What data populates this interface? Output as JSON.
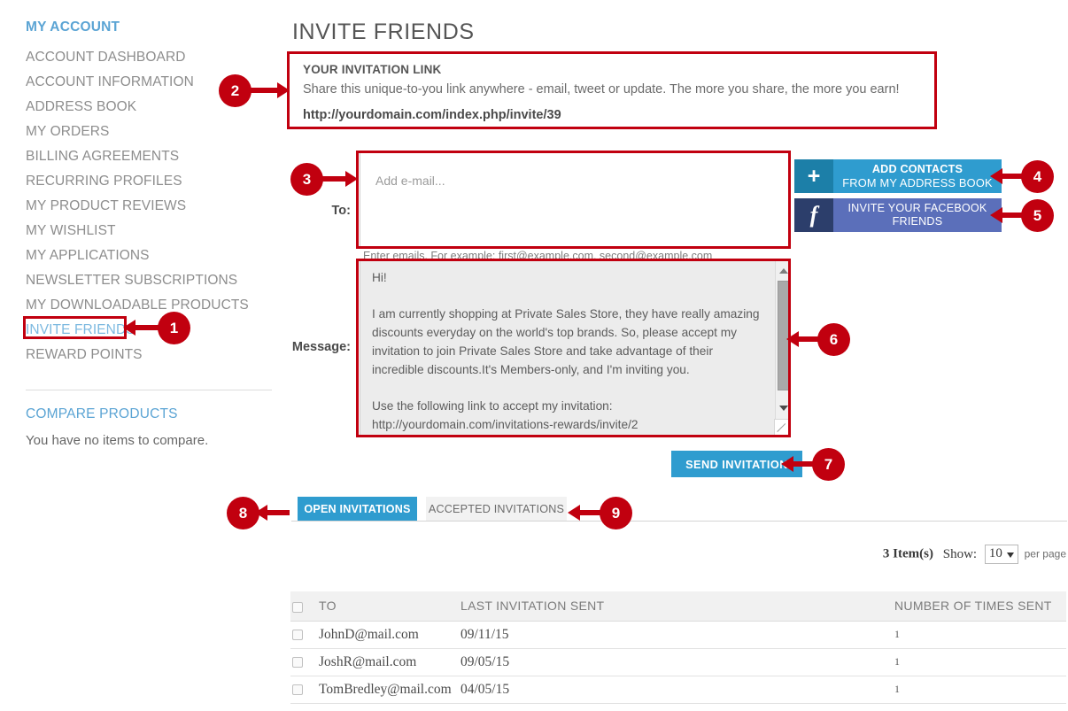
{
  "sidebar": {
    "heading": "MY ACCOUNT",
    "items": [
      {
        "label": "ACCOUNT DASHBOARD",
        "active": false
      },
      {
        "label": "ACCOUNT INFORMATION",
        "active": false
      },
      {
        "label": "ADDRESS BOOK",
        "active": false
      },
      {
        "label": "MY ORDERS",
        "active": false
      },
      {
        "label": "BILLING AGREEMENTS",
        "active": false
      },
      {
        "label": "RECURRING PROFILES",
        "active": false
      },
      {
        "label": "MY PRODUCT REVIEWS",
        "active": false
      },
      {
        "label": "MY WISHLIST",
        "active": false
      },
      {
        "label": "MY APPLICATIONS",
        "active": false
      },
      {
        "label": "NEWSLETTER SUBSCRIPTIONS",
        "active": false
      },
      {
        "label": "MY DOWNLOADABLE PRODUCTS",
        "active": false
      },
      {
        "label": "INVITE FRIENDS",
        "active": true
      },
      {
        "label": "REWARD POINTS",
        "active": false
      }
    ],
    "compare": {
      "heading": "COMPARE PRODUCTS",
      "empty_text": "You have no items to compare."
    }
  },
  "main": {
    "page_title": "INVITE FRIENDS",
    "invitation_panel": {
      "title": "YOUR INVITATION LINK",
      "description": "Share this unique-to-you link anywhere - email, tweet or update. The more you share, the more you earn!",
      "link": "http://yourdomain.com/index.php/invite/39"
    },
    "form": {
      "to_label": "To:",
      "to_placeholder": "Add e-mail...",
      "to_hint": "Enter emails. For example: first@example.com, second@example.com",
      "message_label": "Message:",
      "message_value": "Hi!\n\nI am currently shopping at Private Sales Store, they have really amazing discounts everyday on the world's top brands. So, please accept my invitation to join Private Sales Store and take advantage of their incredible discounts.It's Members-only, and I'm inviting you.\n\nUse the following link to accept my invitation:\nhttp://yourdomain.com/invitations-rewards/invite/2\n",
      "send_button": "SEND INVITATION"
    },
    "actions": {
      "add_contacts": {
        "line1": "ADD CONTACTS",
        "line2": "FROM MY ADDRESS BOOK",
        "icon": "plus-icon"
      },
      "facebook": {
        "line1": "INVITE YOUR FACEBOOK",
        "line2": "FRIENDS",
        "icon": "facebook-icon"
      }
    },
    "tabs": [
      {
        "label": "OPEN INVITATIONS",
        "selected": true
      },
      {
        "label": "ACCEPTED INVITATIONS",
        "selected": false
      }
    ],
    "toolbar": {
      "item_count": "3 Item(s)",
      "show_label": "Show:",
      "per_page_value": "10",
      "per_page_suffix": "per page"
    },
    "table": {
      "columns": [
        "TO",
        "LAST INVITATION SENT",
        "NUMBER OF TIMES SENT"
      ],
      "rows": [
        {
          "to": "JohnD@mail.com",
          "last_sent": "09/11/15",
          "times": "1"
        },
        {
          "to": "JoshR@mail.com",
          "last_sent": "09/05/15",
          "times": "1"
        },
        {
          "to": "TomBredley@mail.com",
          "last_sent": "04/05/15",
          "times": "1"
        }
      ]
    }
  },
  "callouts": [
    {
      "number": "1"
    },
    {
      "number": "2"
    },
    {
      "number": "3"
    },
    {
      "number": "4"
    },
    {
      "number": "5"
    },
    {
      "number": "6"
    },
    {
      "number": "7"
    },
    {
      "number": "8"
    },
    {
      "number": "9"
    }
  ],
  "colors": {
    "accent_blue": "#2f9ccf",
    "link_blue": "#5ba4d4",
    "callout_red": "#c1000f",
    "facebook_blue": "#5b6fba",
    "facebook_dark": "#2c3e6b",
    "contacts_dark": "#1c7fa8",
    "text_gray": "#8d8d8d"
  }
}
